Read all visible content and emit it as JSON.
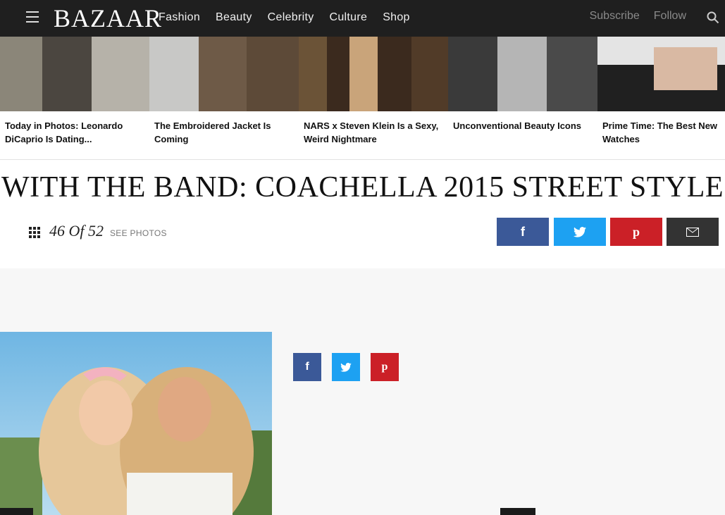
{
  "header": {
    "logo": "BAZAAR",
    "nav": [
      "Fashion",
      "Beauty",
      "Celebrity",
      "Culture",
      "Shop"
    ],
    "subscribe": "Subscribe",
    "follow": "Follow"
  },
  "strip": [
    {
      "caption": "Today in Photos: Leonardo DiCaprio Is Dating..."
    },
    {
      "caption": "The Embroidered Jacket Is Coming"
    },
    {
      "caption": "NARS x Steven Klein Is a Sexy, Weird Nightmare"
    },
    {
      "caption": "Unconventional Beauty Icons"
    },
    {
      "caption": "Prime Time: The Best New Watches"
    }
  ],
  "gallery": {
    "title": "WITH THE BAND: COACHELLA 2015 STREET STYLE",
    "counter": "46 Of 52",
    "see_photos": "SEE PHOTOS"
  },
  "colors": {
    "facebook": "#3b5998",
    "twitter": "#1da1f2",
    "pinterest": "#cb2027",
    "email": "#333333",
    "header": "#1f1f1f"
  }
}
